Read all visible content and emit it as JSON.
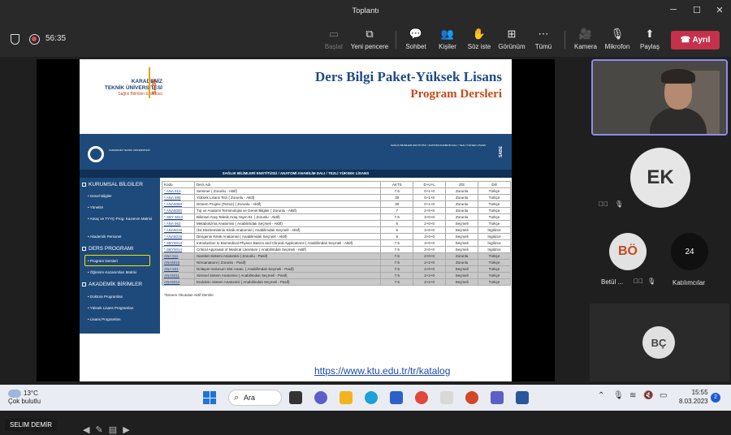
{
  "window": {
    "title": "Toplantı",
    "min": "─",
    "max": "☐",
    "close": "✕"
  },
  "meeting": {
    "timer": "56:35",
    "toolbar": [
      {
        "label": "Başlat",
        "icon": "▭",
        "disabled": true
      },
      {
        "label": "Yeni pencere",
        "icon": "⧉"
      },
      {
        "label": "Sohbet",
        "icon": "💬"
      },
      {
        "label": "Kişiler",
        "icon": "👥"
      },
      {
        "label": "Söz iste",
        "icon": "✋"
      },
      {
        "label": "Görünüm",
        "icon": "⊞"
      },
      {
        "label": "Tümü",
        "icon": "⋯"
      },
      {
        "label": "Kamera",
        "icon": "🎥"
      },
      {
        "label": "Mikrofon",
        "icon": "🎙"
      },
      {
        "label": "Paylaş",
        "icon": "⬆"
      }
    ],
    "leave_label": "Ayrıl",
    "presenter_name": "SELIM DEMİR",
    "link": "https://www.ktu.edu.tr/tr/katalog",
    "participants": {
      "ek": "EK",
      "bo": "BÖ",
      "bo_name": "Betül ...",
      "bc": "BÇ",
      "count": "24",
      "count_label": "Katılımcılar"
    }
  },
  "slide": {
    "logo_line1": "KARADENİZ",
    "logo_line2": "TEKNİK ÜNİVERSİTESİ",
    "logo_line3": "Sağlık Bilimleri Enstitüsü",
    "logo_sabe": "SABE",
    "title1": "Ders Bilgi Paket-Yüksek Lisans",
    "title2": "Program Dersleri",
    "banner_left": "KARADENİZ TEKNİK ÜNİVERSİTESİ",
    "banner_right": "SAĞLIK BİLİMLERİ ENSTİTÜSÜ / ANATOMİ ANABİLİM DALI / TEZLİ YÜKSEK LİSANS",
    "banner_sabe": "SABE",
    "breadcrumb": "SAĞLIK BİLİMLERİ ENSTİTÜSÜ / ANATOMİ ANABİLİM DALI / TEZLİ YÜKSEK LİSANS",
    "sidebar": {
      "h1": "KURUMSAL BİLGİLER",
      "items1": [
        "Genel Bilgiler",
        "Yönetim",
        "Amaç ve TYYÇ-Prog. Kazanım Matrisi",
        "Akademik Personel"
      ],
      "h2": "DERS PROGRAMI",
      "items2": [
        "Program Dersleri",
        "Öğrenim Kazanımları Matrisi"
      ],
      "h3": "AKADEMİK BİRİMLER",
      "items3": [
        "Doktora Programları",
        "Yüksek Lisans Programları",
        "Lisans Programları"
      ]
    },
    "table": {
      "headers": [
        "Kodu",
        "Ders Adı",
        "AKTS",
        "D+U+L",
        "Z/S",
        "Dili"
      ],
      "rows": [
        [
          "* ANA 513",
          "Seminer ( Zorunlu - Aktif)",
          "7.5",
          "0+1+0",
          "Zorunlu",
          "Türkçe"
        ],
        [
          "* ANA 595",
          "Yüksek Lisans Tezi ( Zorunlu - Aktif)",
          "30",
          "0+1+0",
          "Zorunlu",
          "Türkçe"
        ],
        [
          "* ANA5000",
          "Dönem Projesi (Tezsiz) ( Zorunlu - Aktif)",
          "30",
          "0+1+0",
          "Zorunlu",
          "Türkçe"
        ],
        [
          "* ANA5000",
          "Tıp ve Anatomi Terminolojisi ve Genel Bilgiler ( Zorunlu - Aktif)",
          "7",
          "2+0+0",
          "Zorunlu",
          "Türkçe"
        ],
        [
          "* SBY 5012",
          "Bilimsel Araş.Teknik.Araş.Yayın Et. ( Zorunlu - Aktif)",
          "7.5",
          "3+0+0",
          "Zorunlu",
          "Türkçe"
        ],
        [
          "* ANA 562",
          "Metabolizma Anatomisi ( Anabilimdalı Seçmeli - Aktif)",
          "6",
          "2+0+0",
          "Seçmeli",
          "Türkçe"
        ],
        [
          "* ANA5018",
          "Üst Ekstremitenin Klinik Anatomisi ( Anabilimdalı Seçmeli - Aktif)",
          "6",
          "3+0+0",
          "Seçmeli",
          "İngilizce"
        ],
        [
          "* ANA5019",
          "Dengenin Klinik Anatomisi ( Anabilimdalı Seçmeli - Aktif)",
          "6",
          "3+0+0",
          "Seçmeli",
          "İngilizce"
        ],
        [
          "* SBY5013",
          "Introduction to Biomedical Physics Basics and Clinical Applications ( Anabilimdalı Seçmeli - Aktif)",
          "7.5",
          "3+0+0",
          "Seçmeli",
          "İngilizce"
        ],
        [
          "* SBY5014",
          "Critical Appraisal of Medical Literature ( Anabilimdalı Seçmeli - Aktif)",
          "7.5",
          "3+0+0",
          "Seçmeli",
          "İngilizce"
        ],
        [
          "ANA 511",
          "Hareket Sistemi Anatomisi ( Zorunlu - Pasif)",
          "7.5",
          "2+0+0",
          "Zorunlu",
          "Türkçe"
        ],
        [
          "ANA5015",
          "Nöroanatomi ( Zorunlu - Pasif)",
          "7.5",
          "2+2+0",
          "Zorunlu",
          "Türkçe"
        ],
        [
          "ANA 531",
          "Dolaşım-Solunum Sist.Anato. ( Anabilimdalı Seçmeli - Pasif)",
          "7.5",
          "2+0+0",
          "Seçmeli",
          "Türkçe"
        ],
        [
          "ANA5011",
          "Sinirsel Sistem Anatomisi ( Anabilimdalı Seçmeli - Pasif)",
          "7.5",
          "2+2+0",
          "Seçmeli",
          "Türkçe"
        ],
        [
          "ANA5012",
          "Endokrin Sistem Anatomisi ( Anabilimdalı Seçmeli - Pasif)",
          "7.5",
          "2+2+0",
          "Seçmeli",
          "Türkçe"
        ]
      ],
      "note": "*Dönem Okutulan Aktif Dersler"
    }
  },
  "taskbar": {
    "temp": "13°C",
    "weather": "Çok bulutlu",
    "search": "Ara",
    "time": "15:55",
    "date": "8.03.2023",
    "notif": "2",
    "colors": {
      "start": "#1e74d6",
      "leave": "#c4314b",
      "teams_accent": "#8e8bf0"
    }
  }
}
